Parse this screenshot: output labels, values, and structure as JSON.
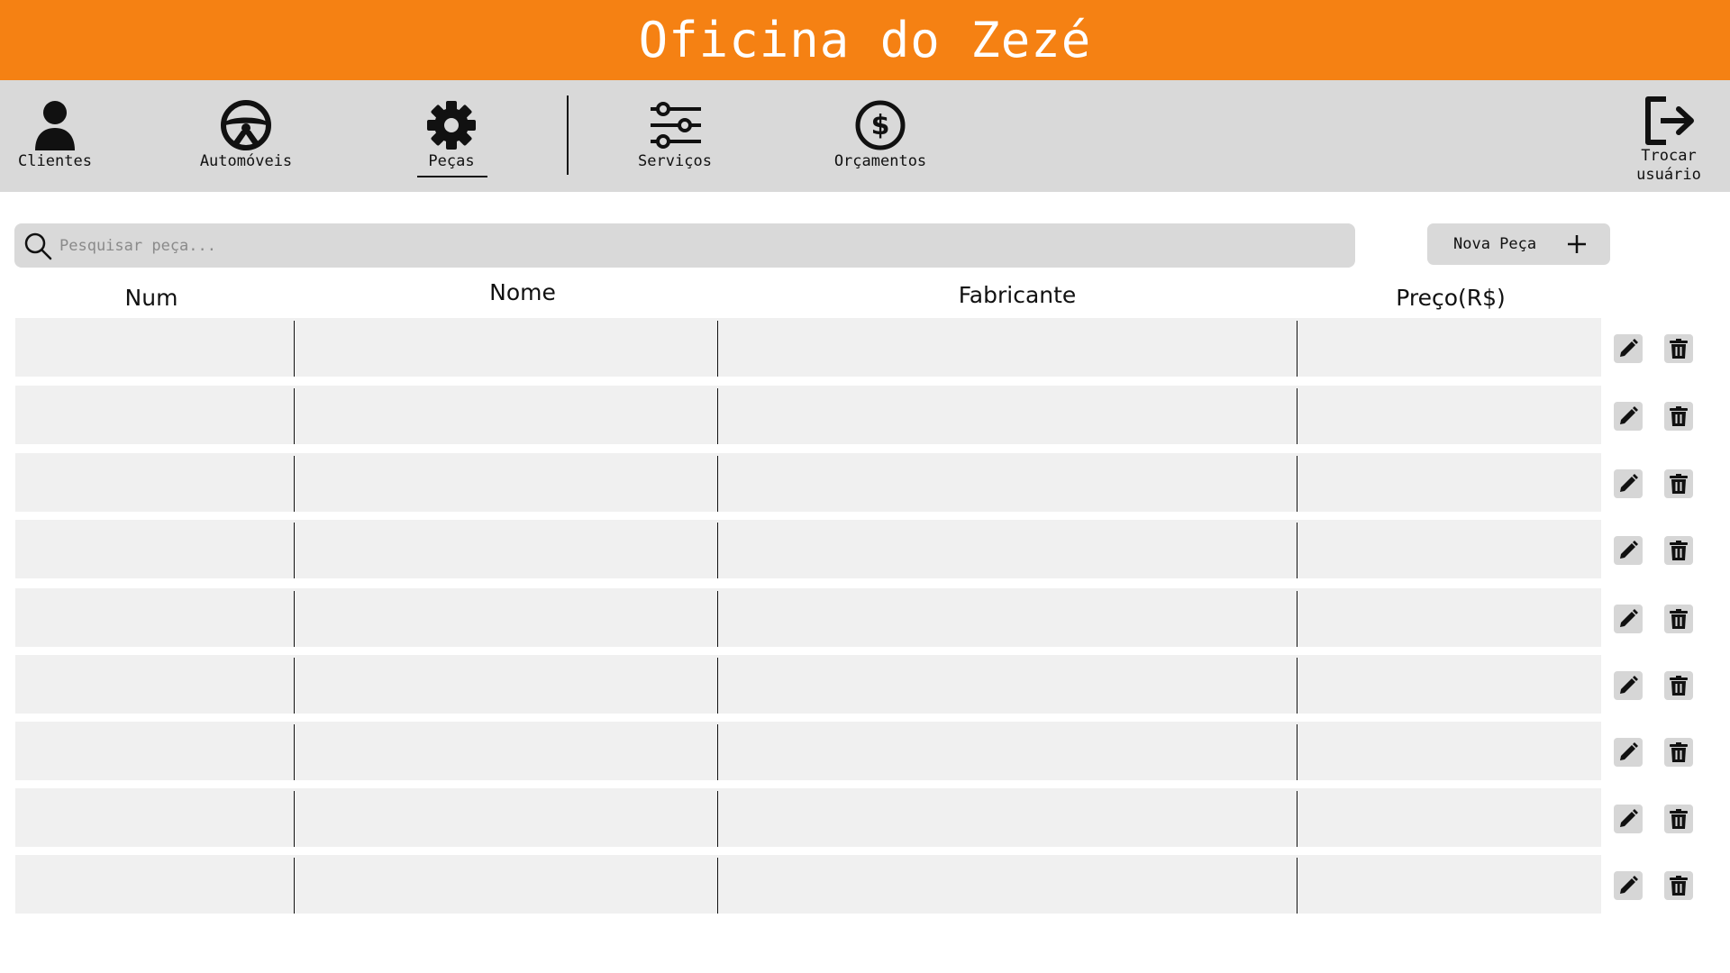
{
  "app": {
    "title": "Oficina do Zezé",
    "accent_color": "#f58113"
  },
  "nav": {
    "items": [
      {
        "label": "Clientes",
        "icon": "user-icon"
      },
      {
        "label": "Automóveis",
        "icon": "steering-wheel-icon"
      },
      {
        "label": "Peças",
        "icon": "gear-icon",
        "active": true
      },
      {
        "label": "Serviços",
        "icon": "sliders-icon"
      },
      {
        "label": "Orçamentos",
        "icon": "dollar-circle-icon"
      }
    ],
    "logout": {
      "label": "Trocar\nusuário",
      "icon": "logout-icon"
    }
  },
  "search": {
    "placeholder": "Pesquisar peça...",
    "value": ""
  },
  "new_button": {
    "label": "Nova Peça",
    "icon": "plus-icon"
  },
  "table": {
    "columns": [
      "Num",
      "Nome",
      "Fabricante",
      "Preço(R$)"
    ],
    "rows": [
      [
        "",
        "",
        "",
        ""
      ],
      [
        "",
        "",
        "",
        ""
      ],
      [
        "",
        "",
        "",
        ""
      ],
      [
        "",
        "",
        "",
        ""
      ],
      [
        "",
        "",
        "",
        ""
      ],
      [
        "",
        "",
        "",
        ""
      ],
      [
        "",
        "",
        "",
        ""
      ],
      [
        "",
        "",
        "",
        ""
      ],
      [
        "",
        "",
        "",
        ""
      ]
    ],
    "row_actions": [
      "pencil-icon",
      "trash-icon"
    ]
  }
}
